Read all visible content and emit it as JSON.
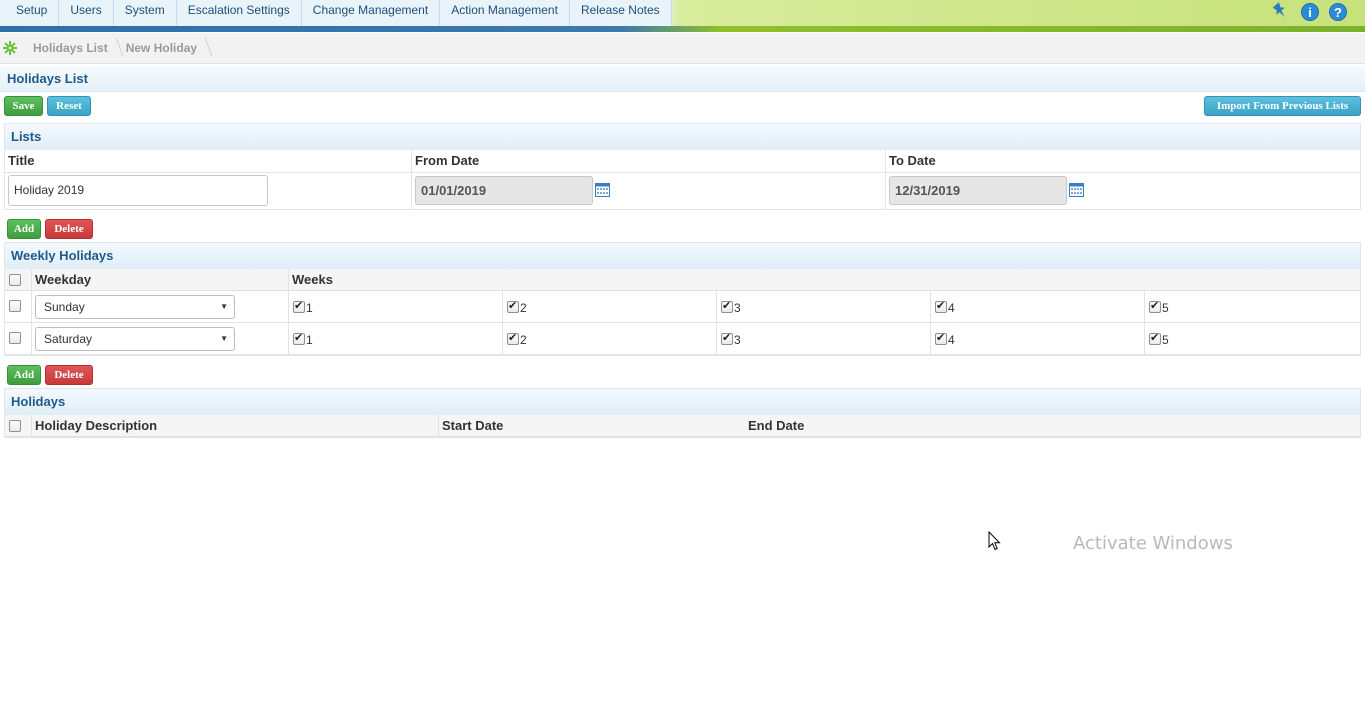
{
  "nav": {
    "items": [
      {
        "label": "Setup"
      },
      {
        "label": "Users"
      },
      {
        "label": "System"
      },
      {
        "label": "Escalation Settings"
      },
      {
        "label": "Change Management"
      },
      {
        "label": "Action Management"
      },
      {
        "label": "Release Notes"
      }
    ],
    "icons": [
      "pin-icon",
      "info-icon",
      "help-icon"
    ],
    "info_glyph": "i",
    "help_glyph": "?"
  },
  "breadcrumb": {
    "home_icon": "home-gear-icon",
    "items": [
      "Holidays List",
      "New Holiday"
    ]
  },
  "page": {
    "title": "Holidays List",
    "save_label": "Save",
    "reset_label": "Reset",
    "import_label": "Import From Previous Lists"
  },
  "lists": {
    "heading": "Lists",
    "title_header": "Title",
    "from_header": "From Date",
    "to_header": "To Date",
    "title_value": "Holiday 2019",
    "from_value": "01/01/2019",
    "to_value": "12/31/2019"
  },
  "weekly": {
    "add_label": "Add",
    "delete_label": "Delete",
    "heading": "Weekly Holidays",
    "weekday_header": "Weekday",
    "weeks_header": "Weeks",
    "rows": [
      {
        "weekday": "Sunday",
        "weeks": [
          "1",
          "2",
          "3",
          "4",
          "5"
        ]
      },
      {
        "weekday": "Saturday",
        "weeks": [
          "1",
          "2",
          "3",
          "4",
          "5"
        ]
      }
    ]
  },
  "holidays": {
    "add_label": "Add",
    "delete_label": "Delete",
    "heading": "Holidays",
    "desc_header": "Holiday Description",
    "start_header": "Start Date",
    "end_header": "End Date"
  },
  "system": {
    "watermark": "Activate Windows"
  },
  "colors": {
    "accent": "#1f5a8a",
    "green_button": "#4cae4c",
    "blue_button": "#46b0d2",
    "red_button": "#d43f3f"
  }
}
